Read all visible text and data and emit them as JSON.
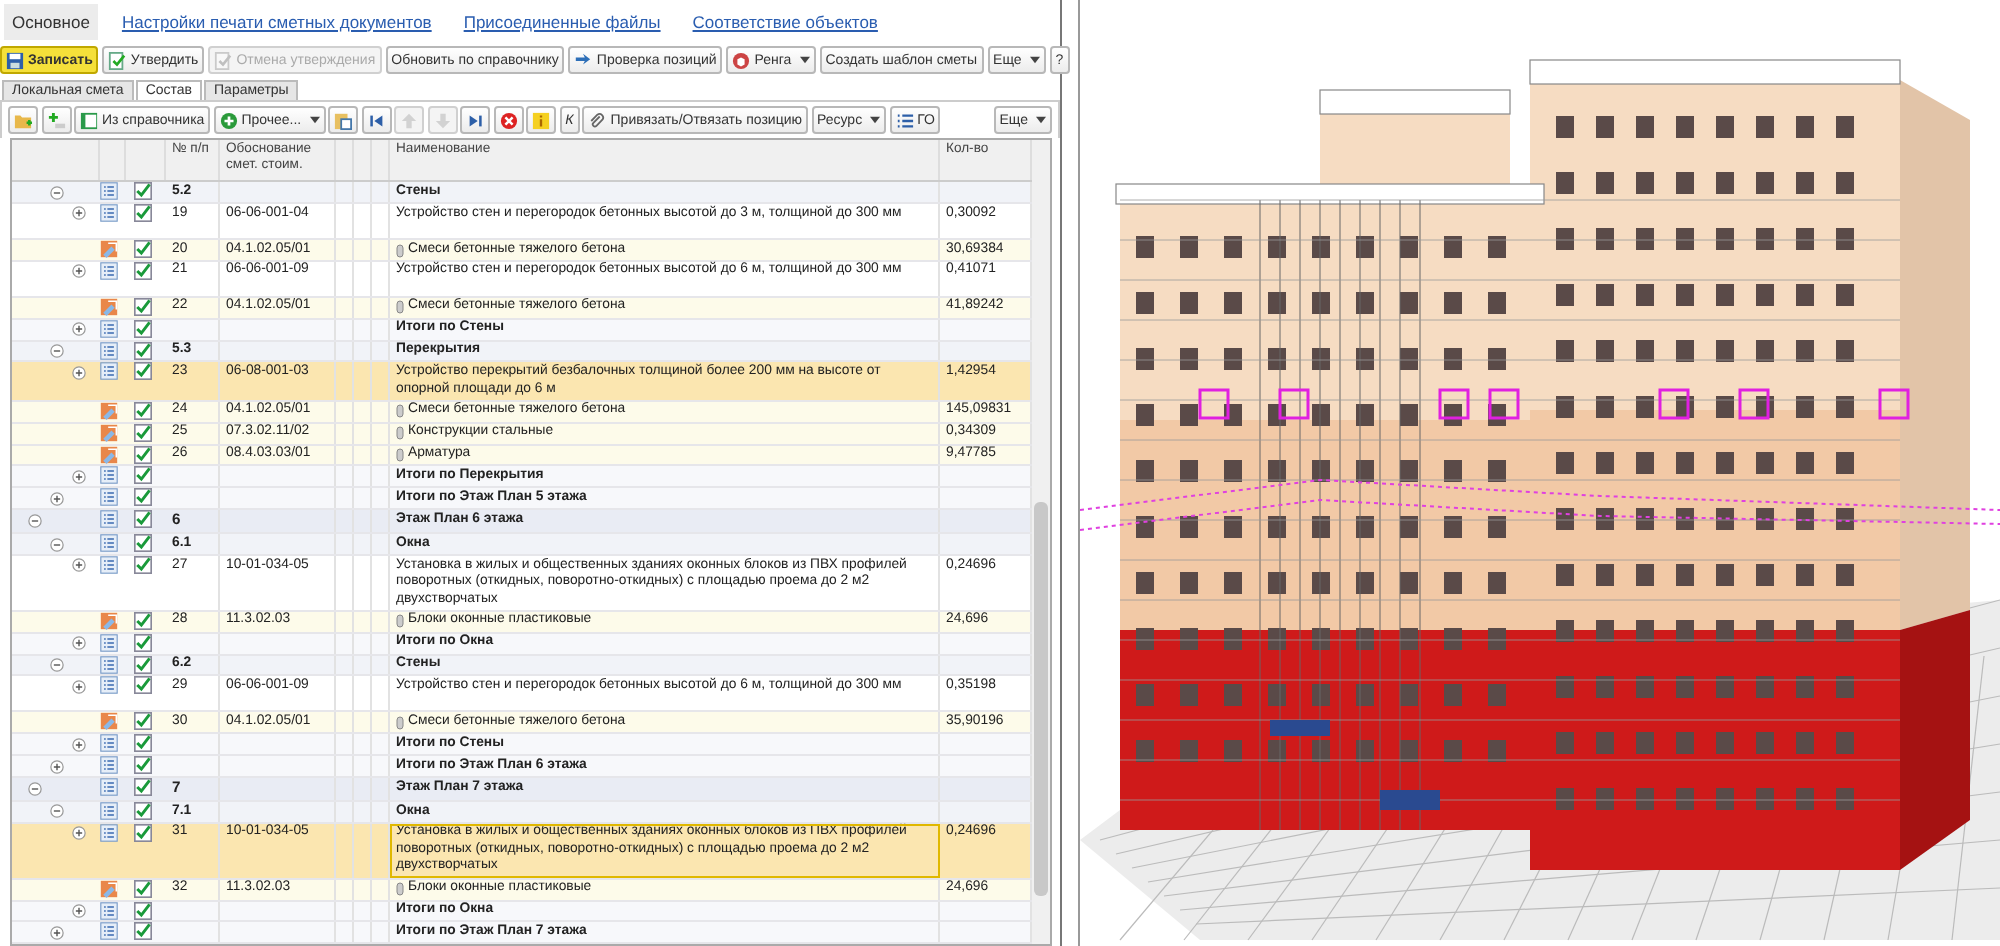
{
  "top_tabs": [
    {
      "label": "Основное",
      "selected": true
    },
    {
      "label": "Настройки печати сметных документов",
      "selected": false
    },
    {
      "label": "Присоединенные файлы",
      "selected": false
    },
    {
      "label": "Соответствие объектов",
      "selected": false
    }
  ],
  "main_toolbar": [
    {
      "label": "Записать",
      "disabled": false,
      "dropdown": false,
      "primary": true
    },
    {
      "label": "Утвердить",
      "disabled": false,
      "dropdown": false,
      "primary": false
    },
    {
      "label": "Отмена утверждения",
      "disabled": true,
      "dropdown": false,
      "primary": false
    },
    {
      "label": "Обновить по справочнику",
      "disabled": false,
      "dropdown": false,
      "primary": false
    },
    {
      "label": "Проверка позиций",
      "disabled": false,
      "dropdown": false,
      "primary": false
    },
    {
      "label": "Ренга",
      "disabled": false,
      "dropdown": true,
      "primary": false
    },
    {
      "label": "Создать шаблон сметы",
      "disabled": false,
      "dropdown": false,
      "primary": false
    },
    {
      "label": "Еще",
      "disabled": false,
      "dropdown": true,
      "primary": false
    },
    {
      "label": "?",
      "disabled": false,
      "dropdown": false,
      "primary": false
    }
  ],
  "sub_tabs": [
    {
      "label": "Локальная смета",
      "selected": false
    },
    {
      "label": "Состав",
      "selected": true
    },
    {
      "label": "Параметры",
      "selected": false
    }
  ],
  "table_toolbar": [
    {
      "disabled": false,
      "dropdown": false
    },
    {
      "disabled": false,
      "dropdown": false
    },
    {
      "label": "Из справочника",
      "disabled": false,
      "dropdown": false
    },
    {
      "label": "Прочее...",
      "disabled": false,
      "dropdown": true
    },
    {
      "disabled": false,
      "dropdown": false
    },
    {
      "disabled": false,
      "dropdown": false
    },
    {
      "disabled": true,
      "dropdown": false
    },
    {
      "disabled": true,
      "dropdown": false
    },
    {
      "disabled": false,
      "dropdown": false
    },
    {
      "disabled": false,
      "dropdown": false
    },
    {
      "disabled": false,
      "dropdown": false
    },
    {
      "label": "К",
      "disabled": false,
      "dropdown": false
    },
    {
      "label": "Привязать/Отвязать позицию",
      "disabled": false,
      "dropdown": false
    },
    {
      "label": "Ресурс",
      "disabled": false,
      "dropdown": true
    },
    {
      "label": "ГО",
      "disabled": false,
      "dropdown": false
    },
    {
      "label": "Еще",
      "disabled": false,
      "dropdown": true
    }
  ],
  "table": {
    "columns": [
      "№ п/п",
      "Обоснование смет. стоим.",
      "Наименование",
      "Кол-во"
    ],
    "rows": [
      {
        "children": [
          {
            "kind": "section",
            "number": "5.2",
            "name": "Стены",
            "expanded": true,
            "checked": true,
            "selected": false,
            "children": [
              {
                "kind": "position",
                "number": "19",
                "code": "06-06-001-04",
                "name": "Устройство стен и перегородок бетонных высотой до 3 м, толщиной до 300 мм",
                "quantity": "0,30092",
                "expanded": false,
                "checked": true,
                "selected": false,
                "children": [
                  {
                    "kind": "resource",
                    "number": "20",
                    "code": "04.1.02.05/01",
                    "name": "Смеси бетонные тяжелого бетона",
                    "quantity": "30,69384",
                    "checked": true,
                    "selected": false
                  }
                ]
              },
              {
                "kind": "position",
                "number": "21",
                "code": "06-06-001-09",
                "name": "Устройство стен и перегородок бетонных высотой до 6 м, толщиной до 300 мм",
                "quantity": "0,41071",
                "expanded": false,
                "checked": true,
                "selected": false,
                "children": [
                  {
                    "kind": "resource",
                    "number": "22",
                    "code": "04.1.02.05/01",
                    "name": "Смеси бетонные тяжелого бетона",
                    "quantity": "41,89242",
                    "checked": true,
                    "selected": false
                  }
                ]
              },
              {
                "kind": "total",
                "name": "Итоги по Стены",
                "expanded": false,
                "checked": true,
                "selected": false
              }
            ]
          },
          {
            "kind": "section",
            "number": "5.3",
            "name": "Перекрытия",
            "expanded": true,
            "checked": true,
            "selected": false,
            "children": [
              {
                "kind": "position",
                "number": "23",
                "code": "06-08-001-03",
                "name": "Устройство перекрытий безбалочных толщиной более 200 мм на высоте от опорной площади до 6 м",
                "quantity": "1,42954",
                "expanded": false,
                "checked": true,
                "selected": true,
                "children": [
                  {
                    "kind": "resource",
                    "number": "24",
                    "code": "04.1.02.05/01",
                    "name": "Смеси бетонные тяжелого бетона",
                    "quantity": "145,09831",
                    "checked": true,
                    "selected": false
                  },
                  {
                    "kind": "resource",
                    "number": "25",
                    "code": "07.3.02.11/02",
                    "name": "Конструкции стальные",
                    "quantity": "0,34309",
                    "checked": true,
                    "selected": false
                  },
                  {
                    "kind": "resource",
                    "number": "26",
                    "code": "08.4.03.03/01",
                    "name": "Арматура",
                    "quantity": "9,47785",
                    "checked": true,
                    "selected": false
                  }
                ]
              },
              {
                "kind": "total",
                "name": "Итоги по Перекрытия",
                "expanded": false,
                "checked": true,
                "selected": false
              }
            ]
          },
          {
            "kind": "total",
            "name": "Итоги по Этаж План 5 этажа",
            "expanded": false,
            "checked": true,
            "selected": false
          }
        ]
      },
      {
        "kind": "floor",
        "number": "6",
        "name": "Этаж План 6 этажа",
        "expanded": true,
        "checked": true,
        "selected": false,
        "children": [
          {
            "kind": "section",
            "number": "6.1",
            "name": "Окна",
            "expanded": true,
            "checked": true,
            "selected": false,
            "children": [
              {
                "kind": "position",
                "number": "27",
                "code": "10-01-034-05",
                "name": "Установка в жилых и общественных зданиях оконных блоков из ПВХ профилей поворотных (откидных, поворотно-откидных) с площадью проема до 2 м2 двухстворчатых",
                "quantity": "0,24696",
                "expanded": false,
                "checked": true,
                "selected": false,
                "children": [
                  {
                    "kind": "resource",
                    "number": "28",
                    "code": "11.3.02.03",
                    "name": "Блоки оконные пластиковые",
                    "quantity": "24,696",
                    "checked": true,
                    "selected": false
                  }
                ]
              },
              {
                "kind": "total",
                "name": "Итоги по Окна",
                "expanded": false,
                "checked": true,
                "selected": false
              }
            ]
          },
          {
            "kind": "section",
            "number": "6.2",
            "name": "Стены",
            "expanded": true,
            "checked": true,
            "selected": false,
            "children": [
              {
                "kind": "position",
                "number": "29",
                "code": "06-06-001-09",
                "name": "Устройство стен и перегородок бетонных высотой до 6 м, толщиной до 300 мм",
                "quantity": "0,35198",
                "expanded": false,
                "checked": true,
                "selected": false,
                "children": [
                  {
                    "kind": "resource",
                    "number": "30",
                    "code": "04.1.02.05/01",
                    "name": "Смеси бетонные тяжелого бетона",
                    "quantity": "35,90196",
                    "checked": true,
                    "selected": false
                  }
                ]
              },
              {
                "kind": "total",
                "name": "Итоги по Стены",
                "expanded": false,
                "checked": true,
                "selected": false
              }
            ]
          },
          {
            "kind": "total",
            "name": "Итоги по Этаж План 6 этажа",
            "expanded": false,
            "checked": true,
            "selected": false
          }
        ]
      },
      {
        "kind": "floor",
        "number": "7",
        "name": "Этаж План 7 этажа",
        "expanded": true,
        "checked": true,
        "selected": false,
        "children": [
          {
            "kind": "section",
            "number": "7.1",
            "name": "Окна",
            "expanded": true,
            "checked": true,
            "selected": false,
            "children": [
              {
                "kind": "position",
                "number": "31",
                "code": "10-01-034-05",
                "name": "Установка в жилых и общественных зданиях оконных блоков из ПВХ профилей поворотных (откидных, поворотно-откидных) с площадью проема до 2 м2 двухстворчатых",
                "quantity": "0,24696",
                "expanded": false,
                "checked": true,
                "selected": true,
                "children": [
                  {
                    "kind": "resource",
                    "number": "32",
                    "code": "11.3.02.03",
                    "name": "Блоки оконные пластиковые",
                    "quantity": "24,696",
                    "checked": true,
                    "selected": false
                  }
                ]
              },
              {
                "kind": "total",
                "name": "Итоги по Окна",
                "expanded": false,
                "checked": true,
                "selected": false
              }
            ]
          },
          {
            "kind": "total",
            "name": "Итоги по Этаж План 7 этажа",
            "expanded": false,
            "checked": true,
            "selected": false
          }
        ]
      }
    ]
  }
}
